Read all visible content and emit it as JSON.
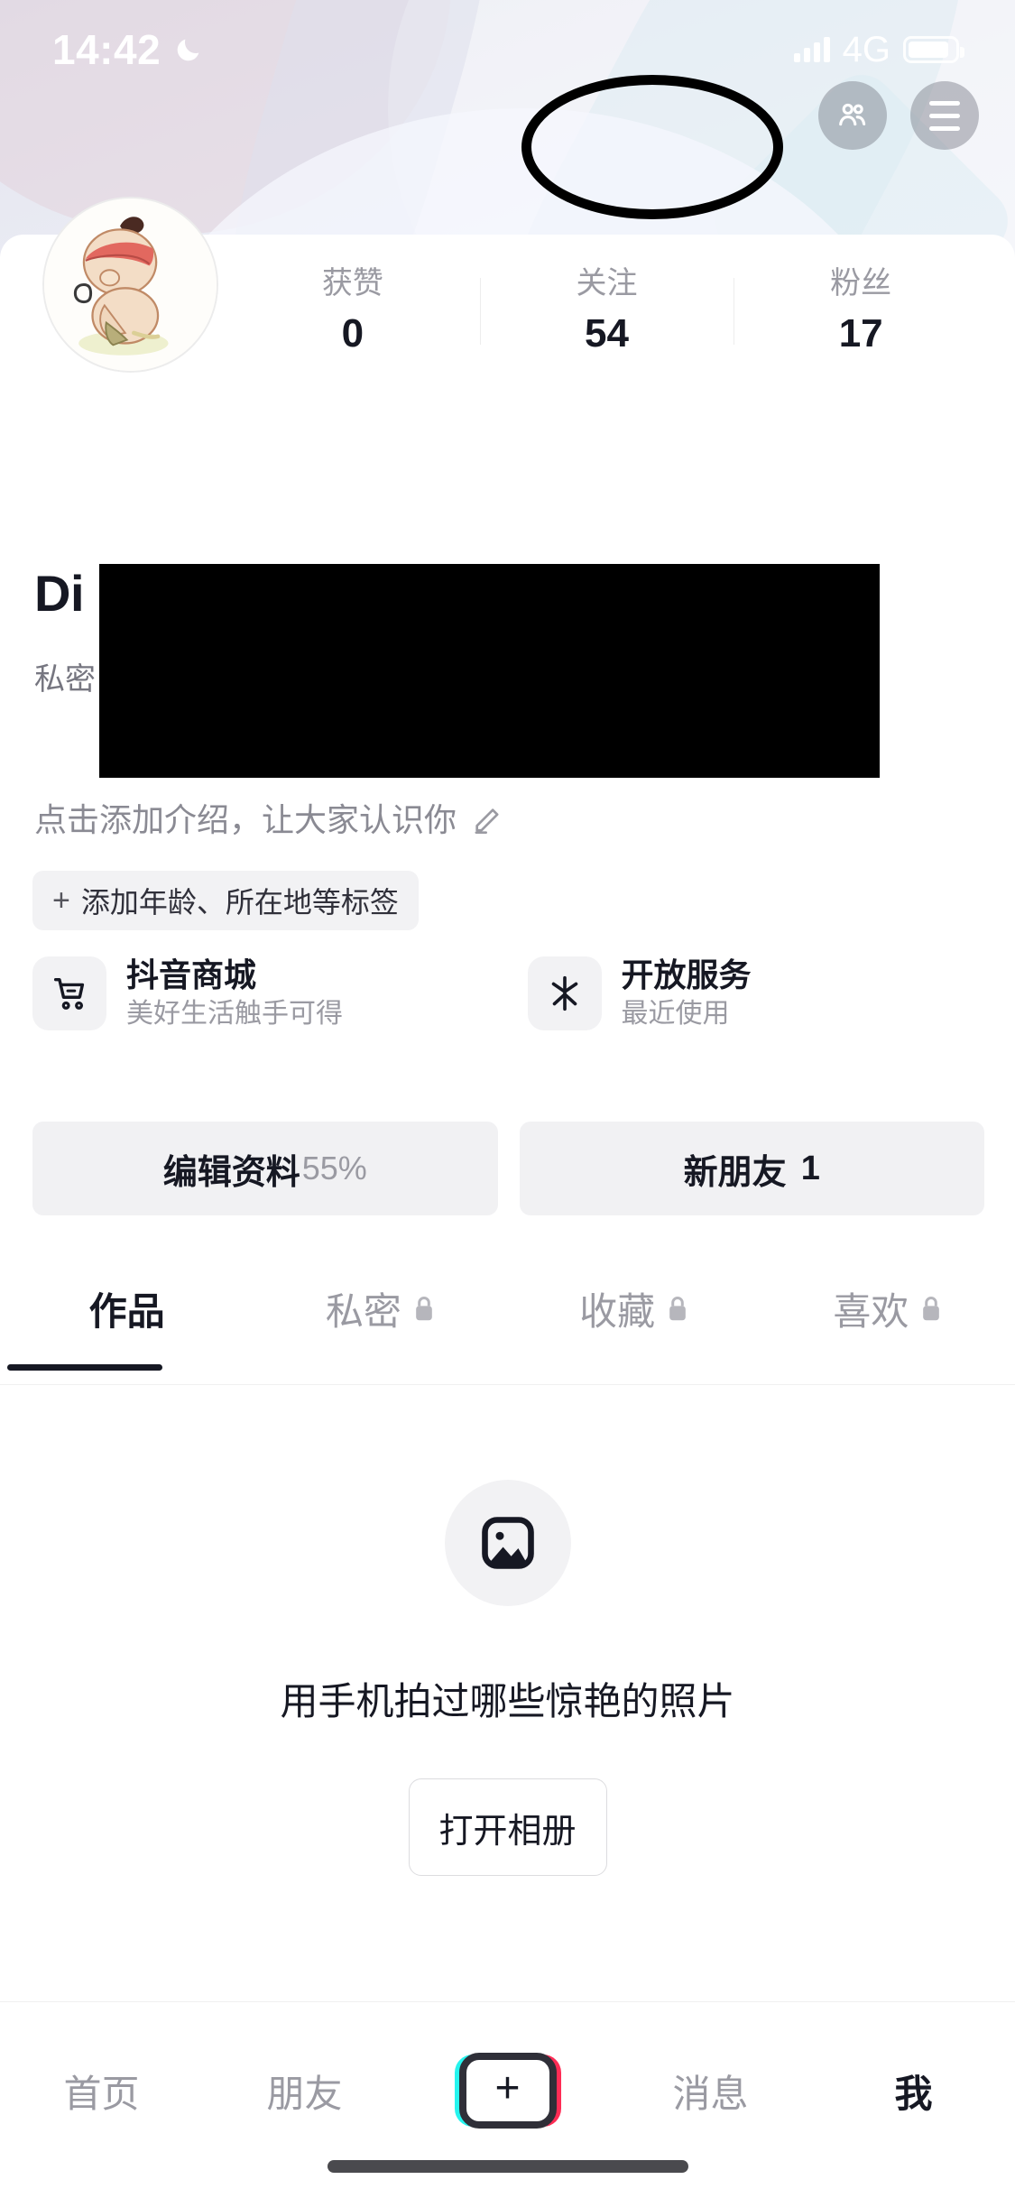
{
  "status_bar": {
    "time": "14:42",
    "dnd_icon": "moon-icon",
    "network": "4G",
    "signal_icon": "signal-bars-icon",
    "battery_icon": "battery-icon"
  },
  "header": {
    "friends_button_icon": "two-people-icon",
    "menu_button_icon": "hamburger-menu-icon",
    "annotation": "black-circle-highlight-on-menu-button"
  },
  "profile": {
    "avatar_icon": "cartoon-character-avatar",
    "username": "Di",
    "username_redacted": true,
    "private_label": "私密",
    "bio_placeholder": "点击添加介绍，让大家认识你",
    "bio_edit_icon": "pencil-icon",
    "tag_button": {
      "plus": "+",
      "label": "添加年龄、所在地等标签"
    },
    "stats": [
      {
        "label": "获赞",
        "value": "0"
      },
      {
        "label": "关注",
        "value": "54"
      },
      {
        "label": "粉丝",
        "value": "17"
      }
    ]
  },
  "services": [
    {
      "icon": "shopping-cart-icon",
      "title": "抖音商城",
      "subtitle": "美好生活触手可得"
    },
    {
      "icon": "douyin-star-icon",
      "title": "开放服务",
      "subtitle": "最近使用"
    }
  ],
  "actions": [
    {
      "label": "编辑资料",
      "badge": "55%"
    },
    {
      "label": "新朋友",
      "badge": "1"
    }
  ],
  "tabs": [
    {
      "label": "作品",
      "locked": false,
      "active": true
    },
    {
      "label": "私密",
      "locked": true,
      "active": false
    },
    {
      "label": "收藏",
      "locked": true,
      "active": false
    },
    {
      "label": "喜欢",
      "locked": true,
      "active": false
    }
  ],
  "empty_state": {
    "icon": "image-placeholder-icon",
    "text": "用手机拍过哪些惊艳的照片",
    "button_label": "打开相册"
  },
  "bottom_nav": [
    {
      "label": "首页",
      "active": false
    },
    {
      "label": "朋友",
      "active": false
    },
    {
      "label": "+",
      "active": false,
      "is_create": true
    },
    {
      "label": "消息",
      "active": false
    },
    {
      "label": "我",
      "active": true
    }
  ],
  "colors": {
    "accent_cyan": "#25f4ee",
    "accent_red": "#fe2c55",
    "text_primary": "#161823",
    "text_secondary": "#9a9aa2",
    "surface": "#f2f2f4"
  }
}
